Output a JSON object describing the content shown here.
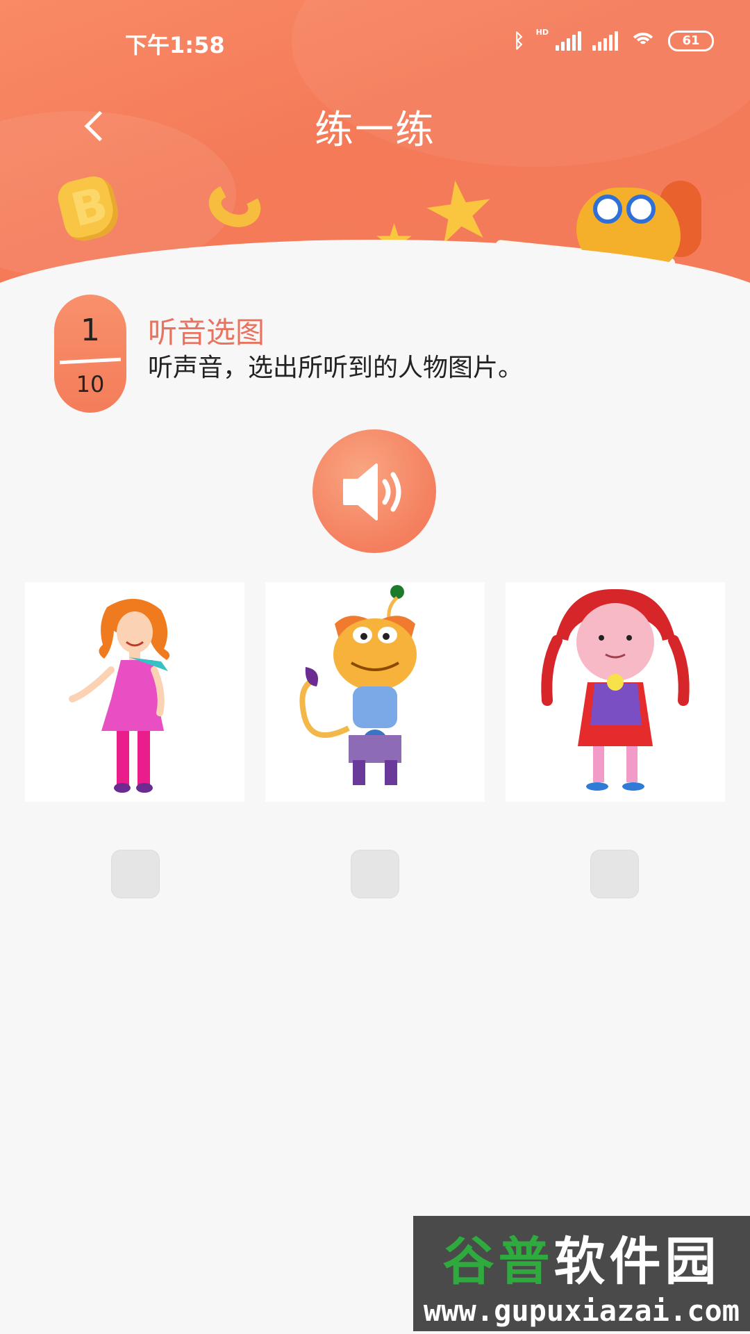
{
  "status_bar": {
    "time": "下午1:58",
    "battery": "61",
    "network_label": "HD"
  },
  "header": {
    "title": "练一练",
    "back_icon": "chevron-left-icon"
  },
  "question": {
    "current": "1",
    "total": "10",
    "type": "听音选图",
    "description": "听声音，选出所听到的人物图片。"
  },
  "audio_button": {
    "icon": "speaker-icon"
  },
  "options": [
    {
      "name": "girl-in-pink-dress"
    },
    {
      "name": "monster-character"
    },
    {
      "name": "girl-with-red-braids"
    }
  ],
  "watermark": {
    "title_part1": "谷普",
    "title_part2": "软件园",
    "url": "www.gupuxiazai.com"
  },
  "colors": {
    "accent": "#f47d5a",
    "question_type": "#e8735f",
    "background": "#f7f7f7"
  }
}
